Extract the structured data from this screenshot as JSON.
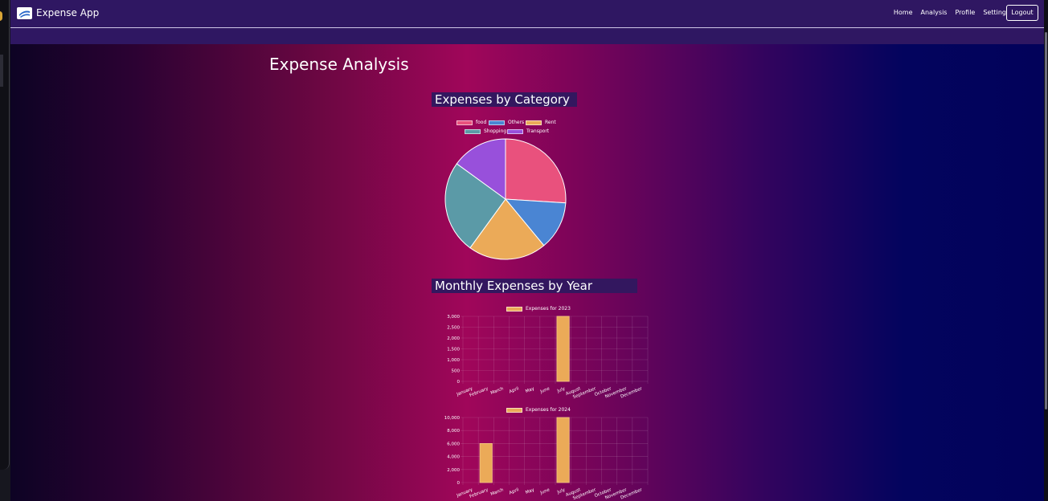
{
  "app": {
    "brand": "Expense App",
    "nav": [
      "Home",
      "Analysis",
      "Profile",
      "Setting"
    ],
    "logout_label": "Logout"
  },
  "page": {
    "title": "Expense Analysis",
    "category_heading": "Expenses by Category",
    "monthly_heading": "Monthly Expenses by Year"
  },
  "icons": {
    "brand": "expense-app-logo-icon"
  },
  "colors": {
    "navbar": "#2f1762",
    "food": "#e9517d",
    "others": "#4a85d3",
    "rent": "#ebaa58",
    "shopping": "#5b9aa7",
    "transport": "#9850db",
    "bar": "#ebaa58"
  },
  "chart_data": [
    {
      "type": "pie",
      "labels": [
        "food",
        "Others",
        "Rent",
        "Shopping",
        "Transport"
      ],
      "values": [
        26,
        13,
        21,
        25,
        15
      ]
    },
    {
      "type": "bar",
      "categories": [
        "January",
        "February",
        "March",
        "April",
        "May",
        "June",
        "July",
        "August",
        "September",
        "October",
        "November",
        "December"
      ],
      "series": [
        {
          "name": "Expenses for 2023",
          "values": [
            0,
            0,
            0,
            0,
            0,
            0,
            3000,
            0,
            0,
            0,
            0,
            0
          ]
        }
      ],
      "ylim": [
        0,
        3000
      ],
      "yticks": [
        "0",
        "500",
        "1,000",
        "1,500",
        "2,000",
        "2,500",
        "3,000"
      ],
      "grid": true,
      "legend": "top"
    },
    {
      "type": "bar",
      "categories": [
        "January",
        "February",
        "March",
        "April",
        "May",
        "June",
        "July",
        "August",
        "September",
        "October",
        "November",
        "December"
      ],
      "series": [
        {
          "name": "Expenses for 2024",
          "values": [
            0,
            6000,
            0,
            0,
            0,
            0,
            10000,
            0,
            0,
            0,
            0,
            0
          ]
        }
      ],
      "ylim": [
        0,
        10000
      ],
      "yticks": [
        "0",
        "2,000",
        "4,000",
        "6,000",
        "8,000",
        "10,000"
      ],
      "grid": true,
      "legend": "top"
    }
  ]
}
